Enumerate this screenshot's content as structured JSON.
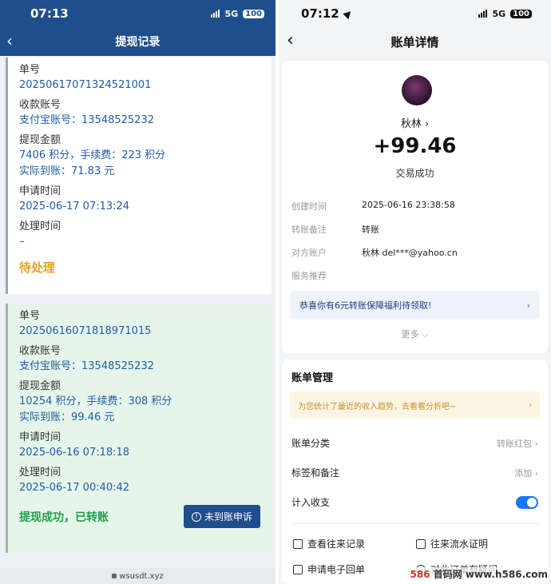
{
  "left": {
    "status_time": "07:13",
    "network": "5G",
    "battery": "100",
    "nav_title": "提现记录",
    "records": [
      {
        "order_label": "单号",
        "order_no": "20250617071324521001",
        "account_label": "收款账号",
        "account_value": "支付宝账号：13548525232",
        "amount_label": "提现金额",
        "amount_line": "7406 积分，手续费：223 积分",
        "actual_line": "实际到账：71.83 元",
        "apply_label": "申请时间",
        "apply_time": "2025-06-17 07:13:24",
        "process_label": "处理时间",
        "process_time": "–",
        "status": "待处理"
      },
      {
        "order_label": "单号",
        "order_no": "20250616071818971015",
        "account_label": "收款账号",
        "account_value": "支付宝账号：13548525232",
        "amount_label": "提现金额",
        "amount_line": "10254 积分，手续费：308 积分",
        "actual_line": "实际到账：99.46 元",
        "apply_label": "申请时间",
        "apply_time": "2025-06-16 07:18:18",
        "process_label": "处理时间",
        "process_time": "2025-06-17 00:40:42",
        "status": "提现成功，已转账",
        "appeal_label": "未到账申诉"
      }
    ],
    "url": "wsusdt.xyz"
  },
  "right": {
    "status_time": "07:12",
    "network": "5G",
    "battery": "100",
    "nav_title": "账单详情",
    "payer_name": "秋林 ›",
    "amount": "+99.46",
    "trade_status": "交易成功",
    "details": [
      {
        "k": "创建时间",
        "v": "2025-06-16 23:38:58"
      },
      {
        "k": "转账备注",
        "v": "转账"
      },
      {
        "k": "对方账户",
        "v": "秋林 del***@yahoo.cn"
      },
      {
        "k": "服务推荐",
        "v": ""
      }
    ],
    "promo": "恭喜你有6元转账保障福利待领取!",
    "more": "更多 ⌵",
    "manage_title": "账单管理",
    "trend_tip": "为您统计了最近的收入趋势，去看看分析吧~",
    "category_label": "账单分类",
    "category_value": "转账红包 ›",
    "tag_label": "标签和备注",
    "tag_value": "添加 ›",
    "count_label": "计入收支",
    "actions": [
      "查看往来记录",
      "往来流水证明",
      "申请电子回单",
      "对此订单有疑问"
    ]
  },
  "watermark": {
    "brand": "586",
    "text": "首码网 www.h586.com"
  },
  "colors": {
    "nav_blue": "#1f4e8c",
    "pending": "#e0a51f",
    "success": "#1fa14a",
    "link": "#1f5da8",
    "toggle": "#1677ff"
  }
}
